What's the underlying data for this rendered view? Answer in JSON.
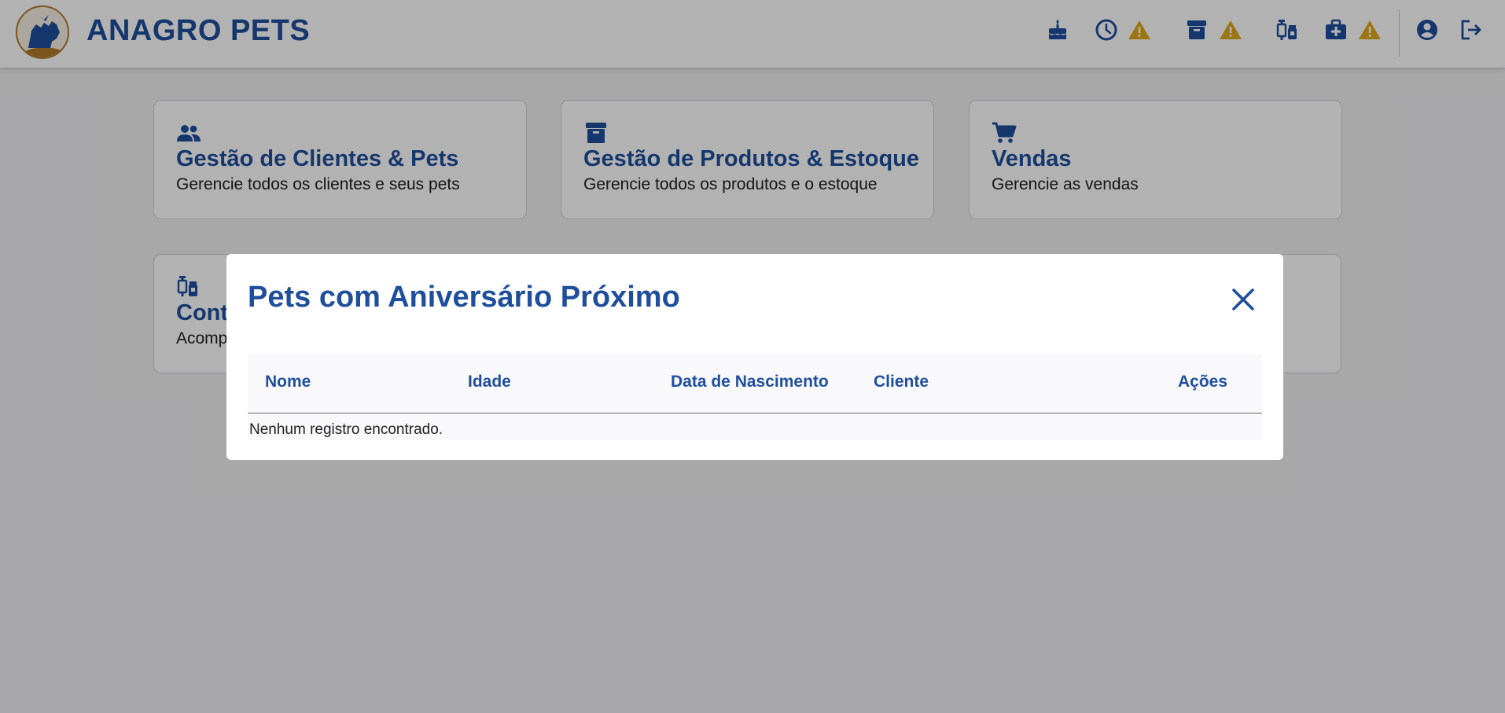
{
  "app": {
    "title": "ANAGRO PETS"
  },
  "header": {
    "icons": [
      "cake-icon",
      "clock-icon",
      "warning-icon",
      "archive-icon",
      "warning-icon",
      "vaccine-icon",
      "medical-kit-icon",
      "warning-icon",
      "account-circle-icon",
      "logout-icon"
    ]
  },
  "cards": [
    {
      "icon": "people-icon",
      "title": "Gestão de Clientes & Pets",
      "description": "Gerencie todos os clientes e seus pets"
    },
    {
      "icon": "archive-icon",
      "title": "Gestão de Produtos & Estoque",
      "description": "Gerencie todos os produtos e o estoque"
    },
    {
      "icon": "cart-icon",
      "title": "Vendas",
      "description": "Gerencie as vendas"
    },
    {
      "icon": "vaccine-icon",
      "title": "Cont",
      "description": "Acomp"
    }
  ],
  "modal": {
    "title": "Pets com Aniversário Próximo",
    "columns": [
      "Nome",
      "Idade",
      "Data de Nascimento",
      "Cliente",
      "Ações"
    ],
    "empty_text": "Nenhum registro encontrado."
  },
  "colors": {
    "primary": "#1f4f9c",
    "warning": "#e0a81c",
    "background": "#f1f1f3"
  }
}
